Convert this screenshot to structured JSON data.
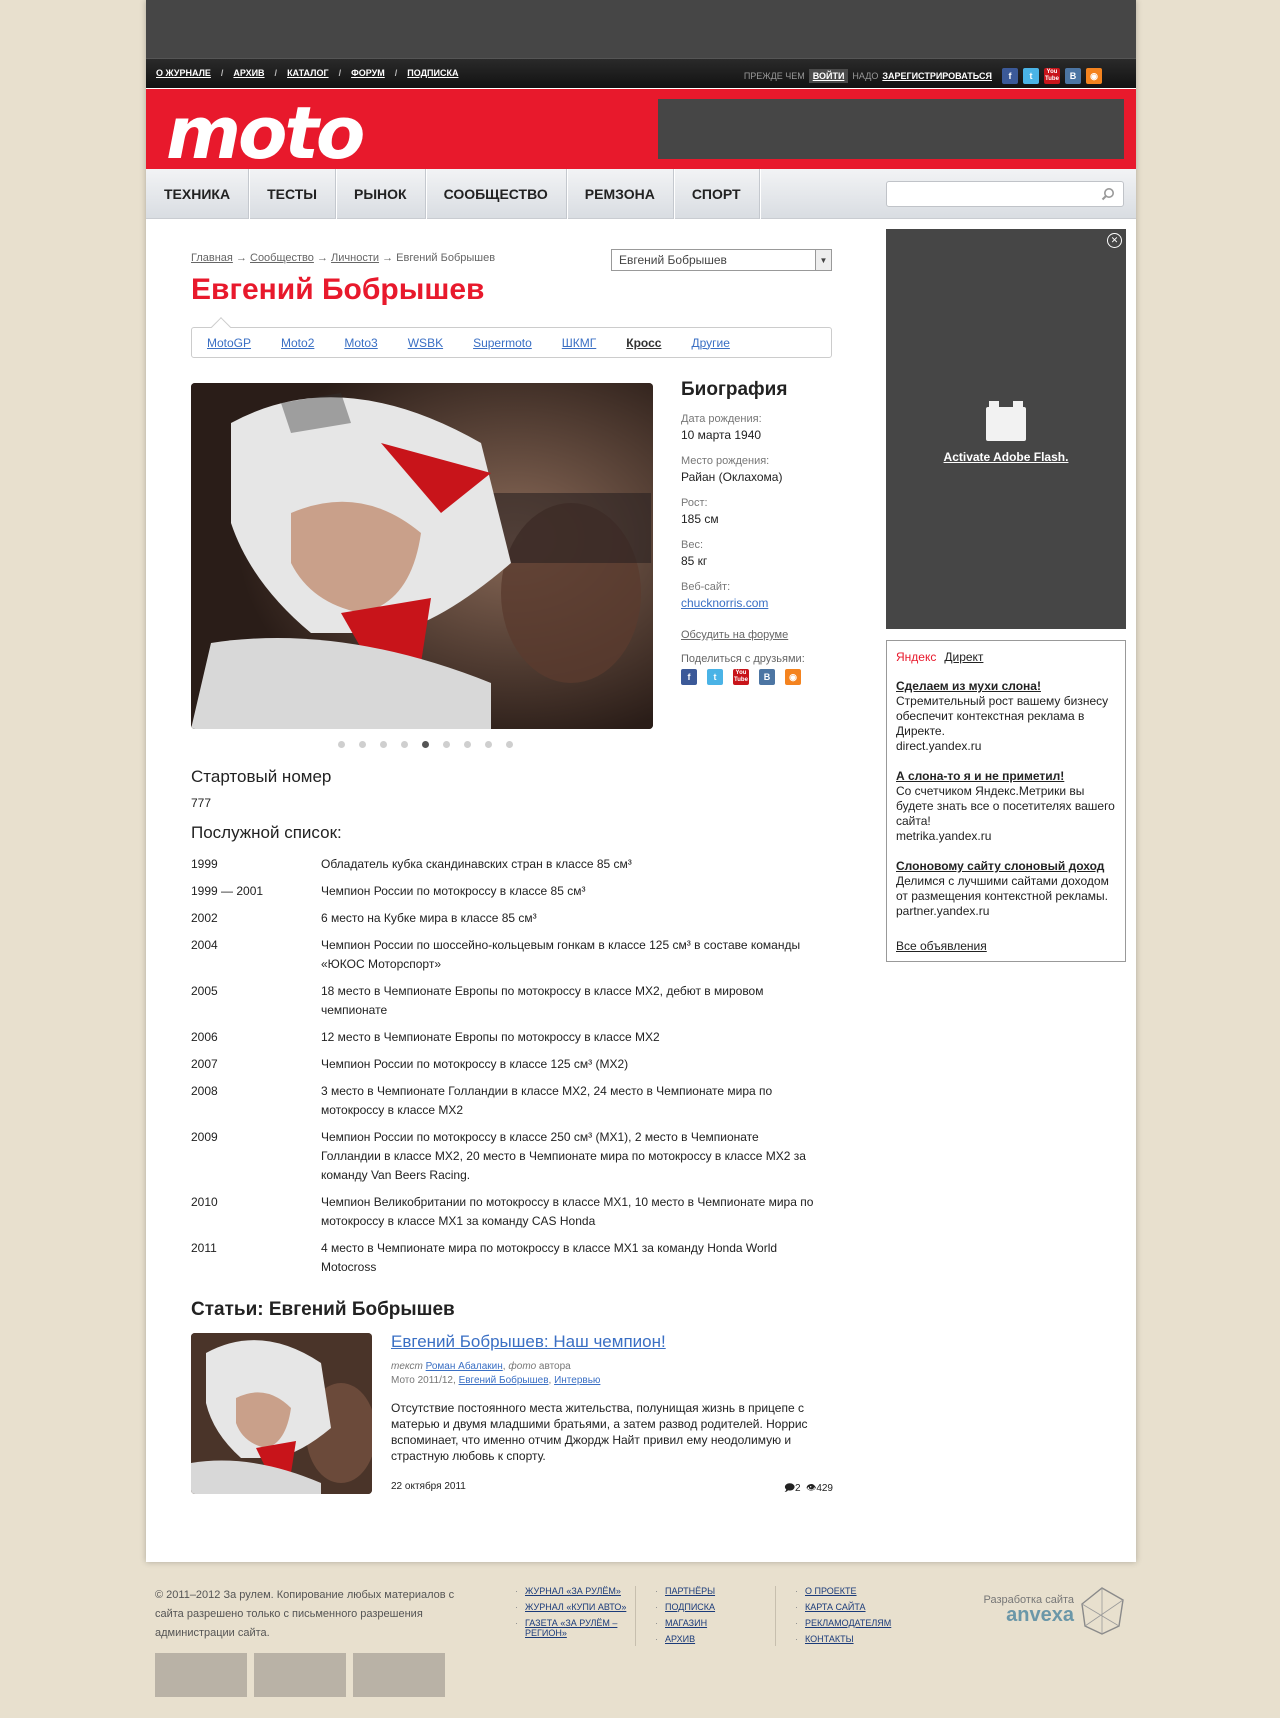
{
  "top_nav": [
    "О ЖУРНАЛЕ",
    "АРХИВ",
    "КАТАЛОГ",
    "ФОРУМ",
    "ПОДПИСКА"
  ],
  "auth": {
    "before": "ПРЕЖДЕ ЧЕМ",
    "login": "ВОЙТИ",
    "need": "НАДО",
    "register": "ЗАРЕГИСТРИРОВАТЬСЯ"
  },
  "social": {
    "fb": "f",
    "tw": "t",
    "yt_top": "You",
    "yt_bottom": "Tube",
    "vk": "B",
    "rss": "◉"
  },
  "logo": "moto",
  "main_nav": [
    "ТЕХНИКА",
    "ТЕСТЫ",
    "РЫНОК",
    "СООБЩЕСТВО",
    "РЕМЗОНА",
    "СПОРТ"
  ],
  "search": {
    "placeholder": ""
  },
  "breadcrumb": {
    "home": "Главная",
    "community": "Сообщество",
    "people": "Личности",
    "current": "Евгений Бобрышев",
    "sep": "→"
  },
  "person_select": "Евгений Бобрышев",
  "title": "Евгений Бобрышев",
  "tabs": [
    "MotoGP",
    "Moto2",
    "Moto3",
    "WSBK",
    "Supermoto",
    "ШКМГ",
    "Кросс",
    "Другие"
  ],
  "active_tab": "Кросс",
  "bio": {
    "heading": "Биография",
    "birth_date_label": "Дата рождения:",
    "birth_date": "10 марта 1940",
    "birth_place_label": "Место рождения:",
    "birth_place": "Райан (Оклахома)",
    "height_label": "Рост:",
    "height": "185 см",
    "weight_label": "Вес:",
    "weight": "85 кг",
    "website_label": "Веб-сайт:",
    "website": "chucknorris.com",
    "forum_link": "Обсудить на форуме",
    "share_label": "Поделиться с друзьями:"
  },
  "gallery": {
    "total": 9,
    "current": 5
  },
  "start_number_heading": "Стартовый номер",
  "start_number": "777",
  "records_heading": "Послужной список:",
  "records": [
    {
      "year": "1999",
      "text": "Обладатель кубка скандинавских стран в классе 85 см³"
    },
    {
      "year": "1999 — 2001",
      "text": "Чемпион России по мотокроссу в классе 85 см³"
    },
    {
      "year": "2002",
      "text": "6 место на Кубке мира в классе 85 см³"
    },
    {
      "year": "2004",
      "text": "Чемпион России по шоссейно-кольцевым гонкам в классе 125 см³ в составе команды «ЮКОС Моторспорт»"
    },
    {
      "year": "2005",
      "text": "18 место в Чемпионате Европы по мотокроссу в классе MX2, дебют в мировом чемпионате"
    },
    {
      "year": "2006",
      "text": "12 место в Чемпионате Европы по мотокроссу в классе MX2"
    },
    {
      "year": "2007",
      "text": "Чемпион России по мотокроссу в классе 125 см³ (MX2)"
    },
    {
      "year": "2008",
      "text": "3 место в Чемпионате Голландии в классе MX2, 24 место в Чемпионате мира по мотокроссу в классе MX2"
    },
    {
      "year": "2009",
      "text": "Чемпион России по мотокроссу в классе 250 см³ (MX1), 2 место в Чемпионате Голландии в классе MX2, 20 место в Чемпионате мира по мотокроссу в классе MX2 за команду Van Beers Racing."
    },
    {
      "year": "2010",
      "text": "Чемпион Великобритании по мотокроссу в классе MX1, 10 место в Чемпионате мира по мотокроссу в классе MX1 за команду CAS Honda"
    },
    {
      "year": "2011",
      "text": "4 место в Чемпионате мира по мотокроссу в классе MX1 за команду Honda World Motocross"
    }
  ],
  "articles_heading": "Статьи: Евгений Бобрышев",
  "article": {
    "title": "Евгений Бобрышев: Наш чемпион!",
    "text_label": "текст",
    "author": "Роман Абалакин",
    "photo_label": "фото",
    "photo_author": "автора",
    "issue": "Мото 2011/12,",
    "tag1": "Евгений Бобрышев",
    "tag2": "Интервью",
    "lead": "Отсутствие постоянного места жительства, полунищая жизнь в прицепе с матерью и двумя младшими братьями, а затем развод родителей. Норрис вспоминает, что именно отчим Джордж Найт привил ему неодолимую и страстную любовь к спорту.",
    "date": "22 октября 2011",
    "comments": "2",
    "views": "429"
  },
  "flash": {
    "activate": "Activate Adobe Flash.",
    "close": "✕"
  },
  "direct": {
    "yandex": "Яндекс",
    "direct": "Директ",
    "ads": [
      {
        "title": "Сделаем из мухи слона!",
        "text": "Стремительный рост вашему бизнесу обеспечит контекстная реклама в Директе.",
        "domain": "direct.yandex.ru"
      },
      {
        "title": "А слона-то я и не приметил!",
        "text": "Со счетчиком Яндекс.Метрики вы будете знать все о посетителях вашего сайта!",
        "domain": "metrika.yandex.ru"
      },
      {
        "title": "Слоновому сайту слоновый доход",
        "text": "Делимся с лучшими сайтами доходом от размещения контекстной рекламы.",
        "domain": "partner.yandex.ru"
      }
    ],
    "all": "Все объявления"
  },
  "footer": {
    "copyright": "© 2011–2012 За рулем. Копирование любых материалов с сайта разрешено только с письменного разрешения администрации сайта.",
    "col1": [
      "ЖУРНАЛ «ЗА РУЛЁМ»",
      "ЖУРНАЛ «КУПИ АВТО»",
      "ГАЗЕТА «ЗА РУЛЁМ – РЕГИОН»"
    ],
    "col2": [
      "ПАРТНЁРЫ",
      "ПОДПИСКА",
      "МАГАЗИН",
      "АРХИВ"
    ],
    "col3": [
      "О ПРОЕКТЕ",
      "КАРТА САЙТА",
      "РЕКЛАМОДАТЕЛЯМ",
      "КОНТАКТЫ"
    ],
    "dev_label": "Разработка сайта",
    "dev_name": "anvexa"
  },
  "colors": {
    "brand_red": "#e8192c",
    "link_blue": "#3a6fc4",
    "page_bg": "#e8e0ce"
  }
}
